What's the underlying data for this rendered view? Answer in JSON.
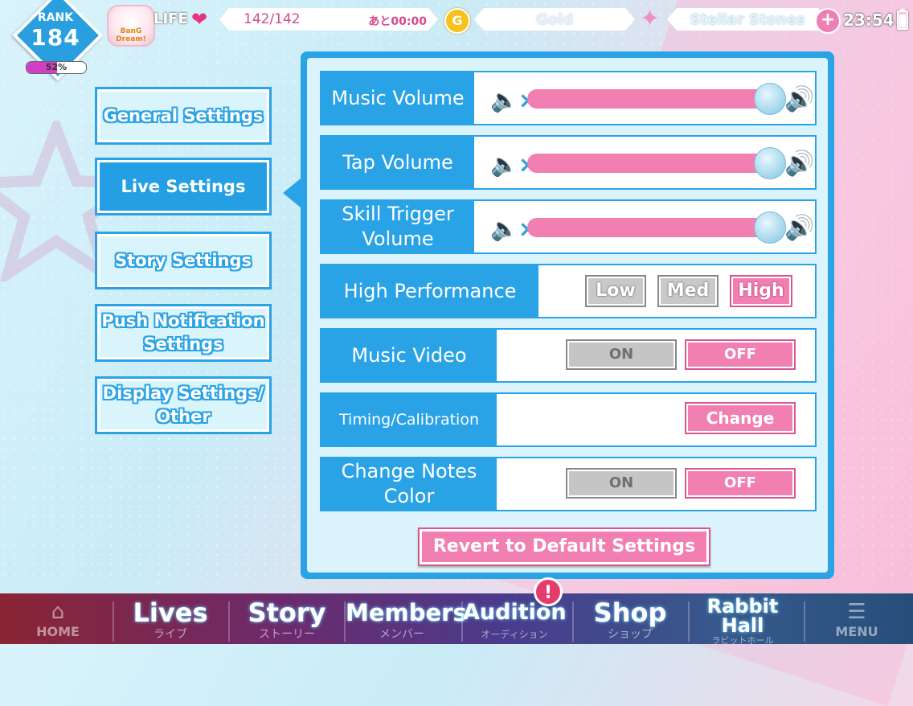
{
  "header": {
    "rank_label": "RANK",
    "rank_value": "184",
    "rank_progress_pct": 52,
    "rank_progress_text": "52%",
    "life_label": "LIFE",
    "life_value": "142/142",
    "life_timer": "あと00:00",
    "gold_icon_text": "G",
    "gold_label": "Gold",
    "stones_label": "Stellar Stones",
    "add_symbol": "+",
    "clock": "23:54"
  },
  "logo_text": "BanG Dream!",
  "sidebar": {
    "items": [
      {
        "label": "General Settings",
        "active": false
      },
      {
        "label": "Live Settings",
        "active": true
      },
      {
        "label": "Story Settings",
        "active": false
      },
      {
        "label": "Push Notification Settings",
        "active": false
      },
      {
        "label": "Display Settings/ Other",
        "active": false
      }
    ]
  },
  "settings": {
    "music_volume": {
      "label": "Music Volume",
      "value_pct": 95
    },
    "tap_volume": {
      "label": "Tap Volume",
      "value_pct": 95
    },
    "skill_volume": {
      "label": "Skill Trigger Volume",
      "value_pct": 95
    },
    "high_performance": {
      "label": "High Performance",
      "options": [
        "Low",
        "Med",
        "High"
      ],
      "selected": "High"
    },
    "music_video": {
      "label": "Music Video",
      "on_label": "ON",
      "off_label": "OFF",
      "selected": "OFF"
    },
    "timing": {
      "label": "Timing/Calibration",
      "button": "Change"
    },
    "notes_color": {
      "label": "Change Notes Color",
      "on_label": "ON",
      "off_label": "OFF",
      "selected": "OFF"
    },
    "revert_button": "Revert to Default Settings"
  },
  "bottom_nav": {
    "home": "HOME",
    "lives": {
      "title": "Lives",
      "sub": "ライブ"
    },
    "story": {
      "title": "Story",
      "sub": "ストーリー"
    },
    "members": {
      "title": "Members",
      "sub": "メンバー"
    },
    "audition": {
      "title": "Audition",
      "sub": "オーディション"
    },
    "shop": {
      "title": "Shop",
      "sub": "ショップ"
    },
    "rabbit_hall": {
      "title": "Rabbit Hall",
      "sub": "ラビットホール"
    },
    "menu": "MENU",
    "alert_badge": "!"
  },
  "colors": {
    "accent_blue": "#2aa3e6",
    "accent_pink": "#f17fb2",
    "panel_bg": "#dbf4fb"
  }
}
